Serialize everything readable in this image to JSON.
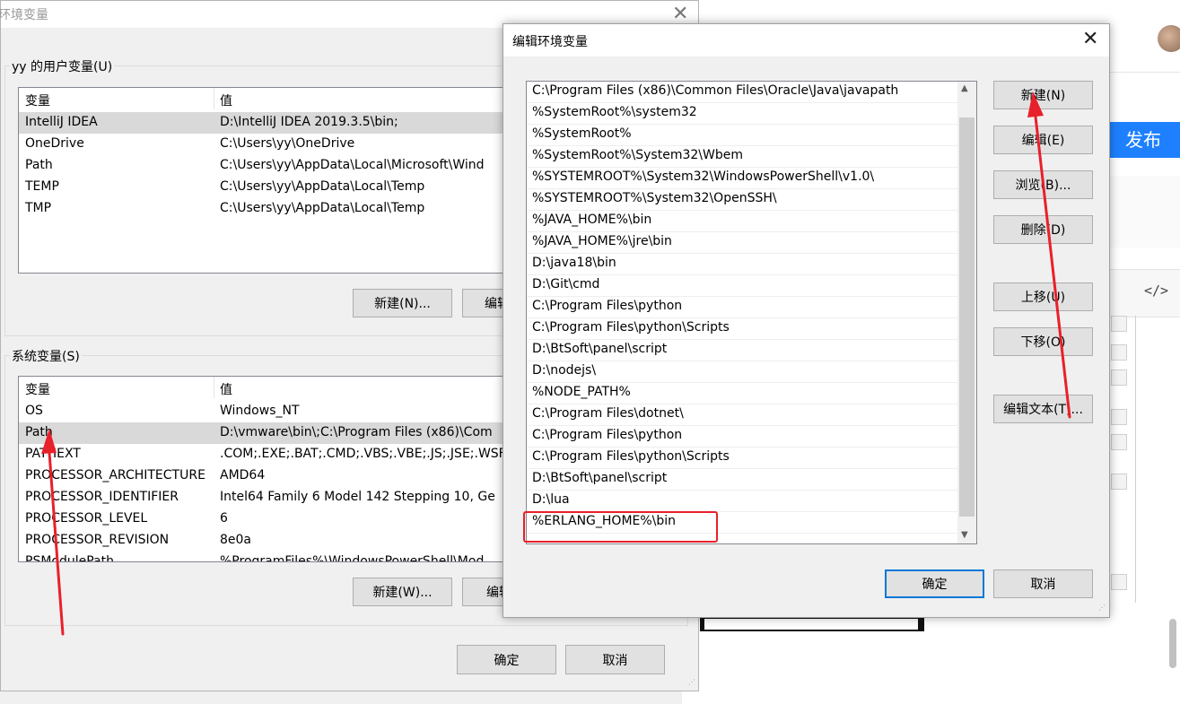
{
  "env_dialog": {
    "title": "环境变量",
    "user_group": {
      "label": "yy 的用户变量(U)",
      "columns": [
        "变量",
        "值"
      ],
      "rows": [
        {
          "name": "IntelliJ IDEA",
          "value": "D:\\IntelliJ IDEA 2019.3.5\\bin;"
        },
        {
          "name": "OneDrive",
          "value": "C:\\Users\\yy\\OneDrive"
        },
        {
          "name": "Path",
          "value": "C:\\Users\\yy\\AppData\\Local\\Microsoft\\Wind"
        },
        {
          "name": "TEMP",
          "value": "C:\\Users\\yy\\AppData\\Local\\Temp"
        },
        {
          "name": "TMP",
          "value": "C:\\Users\\yy\\AppData\\Local\\Temp"
        }
      ],
      "new_button": "新建(N)...",
      "edit_button": "编辑"
    },
    "system_group": {
      "label": "系统变量(S)",
      "columns": [
        "变量",
        "值"
      ],
      "rows": [
        {
          "name": "OS",
          "value": "Windows_NT"
        },
        {
          "name": "Path",
          "value": "D:\\vmware\\bin\\;C:\\Program Files (x86)\\Com"
        },
        {
          "name": "PATHEXT",
          "value": ".COM;.EXE;.BAT;.CMD;.VBS;.VBE;.JS;.JSE;.WSF"
        },
        {
          "name": "PROCESSOR_ARCHITECTURE",
          "value": "AMD64"
        },
        {
          "name": "PROCESSOR_IDENTIFIER",
          "value": "Intel64 Family 6 Model 142 Stepping 10, Ge"
        },
        {
          "name": "PROCESSOR_LEVEL",
          "value": "6"
        },
        {
          "name": "PROCESSOR_REVISION",
          "value": "8e0a"
        },
        {
          "name": "PSModulePath",
          "value": "%ProgramFiles%\\WindowsPowerShell\\Mod"
        }
      ],
      "new_button": "新建(W)...",
      "edit_button": "编辑"
    },
    "ok_button": "确定",
    "cancel_button": "取消"
  },
  "edit_dialog": {
    "title": "编辑环境变量",
    "paths": [
      "C:\\Program Files (x86)\\Common Files\\Oracle\\Java\\javapath",
      "%SystemRoot%\\system32",
      "%SystemRoot%",
      "%SystemRoot%\\System32\\Wbem",
      "%SYSTEMROOT%\\System32\\WindowsPowerShell\\v1.0\\",
      "%SYSTEMROOT%\\System32\\OpenSSH\\",
      "%JAVA_HOME%\\bin",
      "%JAVA_HOME%\\jre\\bin",
      "D:\\java18\\bin",
      "D:\\Git\\cmd",
      "C:\\Program Files\\python",
      "C:\\Program Files\\python\\Scripts",
      "D:\\BtSoft\\panel\\script",
      "D:\\nodejs\\",
      "%NODE_PATH%",
      "C:\\Program Files\\dotnet\\",
      "C:\\Program Files\\python",
      "C:\\Program Files\\python\\Scripts",
      "D:\\BtSoft\\panel\\script",
      "D:\\lua",
      "%ERLANG_HOME%\\bin",
      ""
    ],
    "buttons": {
      "new": "新建(N)",
      "edit": "编辑(E)",
      "browse": "浏览(B)...",
      "delete": "删除(D)",
      "move_up": "上移(U)",
      "move_down": "下移(O)",
      "edit_text": "编辑文本(T)..."
    },
    "ok_button": "确定",
    "cancel_button": "取消"
  },
  "background_app": {
    "publish_button": "发布",
    "code_icon_glyph": "</>"
  },
  "colors": {
    "annotation_red": "#e8202a",
    "publish_blue": "#1e80ff",
    "default_button_border": "#0078d7"
  }
}
